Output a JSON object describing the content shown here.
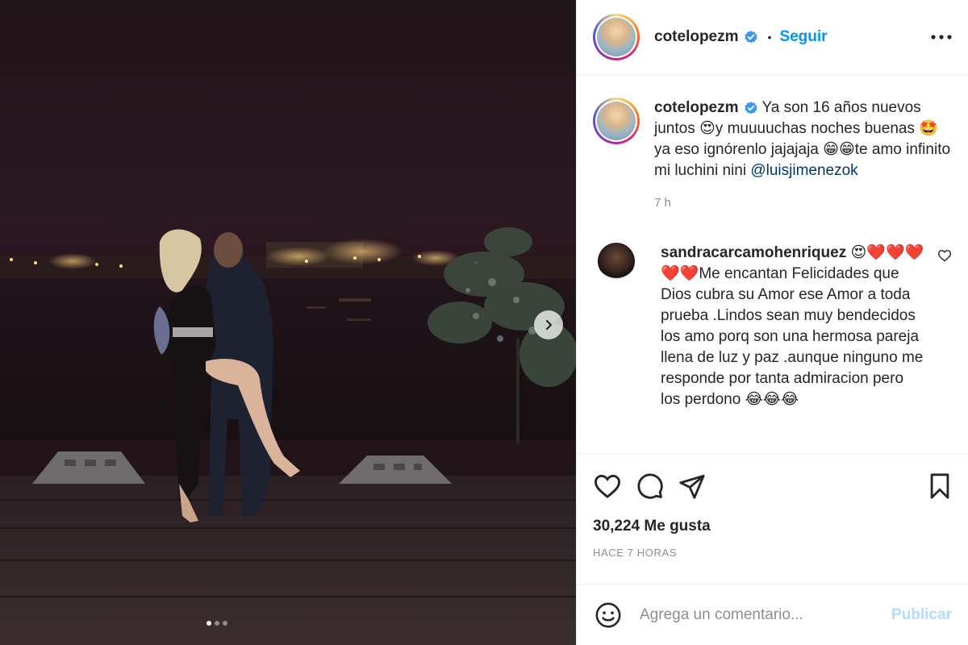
{
  "post": {
    "username": "cotelopezm",
    "follow_label": "Seguir",
    "bullet": "•",
    "caption": {
      "username": "cotelopezm",
      "text_1": " Ya son 16 años nuevos juntos 😍y muuuuchas noches buenas 🤩ya eso ignórenlo jajajaja 😁😁te amo infinito mi luchini nini ",
      "mention": "@luisjimenezok",
      "time": "7 h"
    },
    "comments": [
      {
        "username": "sandracarcamohenriquez",
        "text": " 😍❤️❤️❤️❤️❤️Me encantan Felicidades que Dios cubra su Amor ese Amor a toda prueba .Lindos sean muy bendecidos los amo porq son una hermosa pareja llena de luz y paz .aunque ninguno me responde por tanta admiracion pero los perdono 😂😂😂"
      }
    ],
    "likes": "30,224 Me gusta",
    "time_ago": "HACE 7 HORAS",
    "comment_placeholder": "Agrega un comentario...",
    "publish_label": "Publicar",
    "carousel": {
      "count": 3,
      "active": 0
    }
  },
  "icons": {
    "verified": "verified-badge-icon",
    "more": "more-options-icon",
    "like": "heart-icon",
    "comment": "comment-icon",
    "share": "paper-plane-icon",
    "save": "bookmark-icon",
    "emoji": "smiley-icon",
    "next": "chevron-right-icon"
  },
  "colors": {
    "link": "#0095f6",
    "publish_disabled": "#b3dbff",
    "muted": "#8e8e8e",
    "mention": "#00376b"
  }
}
